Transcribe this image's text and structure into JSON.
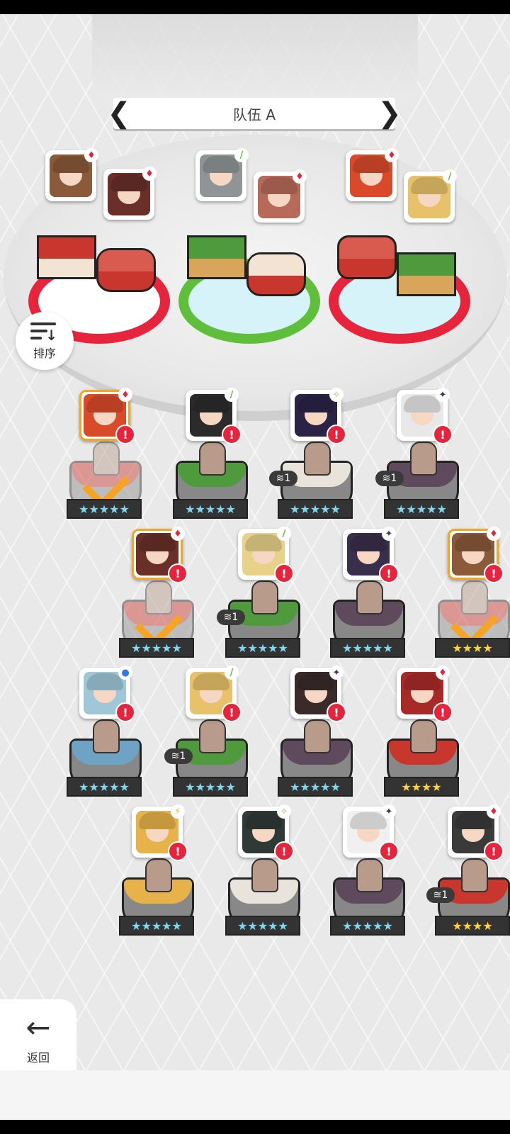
{
  "team": {
    "title": "队伍 A",
    "prev_icon": "chevron-left-icon",
    "next_icon": "chevron-right-icon"
  },
  "sort_button": {
    "label": "排序",
    "icon": "sort-descending-icon"
  },
  "back_button": {
    "label": "返回",
    "icon": "arrow-left-icon"
  },
  "elements": {
    "fire": "♦",
    "nature": "/",
    "light": "✧",
    "dark": "✦",
    "water": "●",
    "electric": "⚡"
  },
  "alert_text": "!",
  "colors": {
    "fire": "#e8243c",
    "nature": "#5fbf3a",
    "selected": "#f5a523",
    "alert": "#e8243c"
  },
  "roster": [
    {
      "id": "r1",
      "element": "fire",
      "stars": "★★★★★",
      "selected": true,
      "duplicates": null
    },
    {
      "id": "r2",
      "element": "nature",
      "stars": "★★★★★",
      "selected": false,
      "duplicates": null
    },
    {
      "id": "r3",
      "element": "light",
      "stars": "★★★★★",
      "selected": false,
      "duplicates": "1"
    },
    {
      "id": "r4",
      "element": "dark",
      "stars": "★★★★★",
      "selected": false,
      "duplicates": "1"
    },
    {
      "id": "r5",
      "element": "fire",
      "stars": "★★★★★",
      "selected": true,
      "duplicates": null
    },
    {
      "id": "r6",
      "element": "nature",
      "stars": "★★★★★",
      "selected": false,
      "duplicates": "1"
    },
    {
      "id": "r7",
      "element": "dark",
      "stars": "★★★★★",
      "selected": false,
      "duplicates": null
    },
    {
      "id": "r8",
      "element": "fire",
      "stars": "★★★★",
      "selected": true,
      "duplicates": null
    },
    {
      "id": "r9",
      "element": "water",
      "stars": "★★★★★",
      "selected": false,
      "duplicates": null
    },
    {
      "id": "r10",
      "element": "nature",
      "stars": "★★★★★",
      "selected": false,
      "duplicates": "1"
    },
    {
      "id": "r11",
      "element": "dark",
      "stars": "★★★★★",
      "selected": false,
      "duplicates": null
    },
    {
      "id": "r12",
      "element": "fire",
      "stars": "★★★★",
      "selected": false,
      "duplicates": null
    },
    {
      "id": "r13",
      "element": "electric",
      "stars": "★★★★★",
      "selected": false,
      "duplicates": null
    },
    {
      "id": "r14",
      "element": "light",
      "stars": "★★★★★",
      "selected": false,
      "duplicates": null
    },
    {
      "id": "r15",
      "element": "dark",
      "stars": "★★★★★",
      "selected": false,
      "duplicates": null
    },
    {
      "id": "r16",
      "element": "fire",
      "stars": "★★★★",
      "selected": false,
      "duplicates": "1"
    }
  ],
  "team_slots": [
    {
      "element": "fire"
    },
    {
      "element": "fire"
    },
    {
      "element": "nature"
    },
    {
      "element": "fire"
    },
    {
      "element": "fire"
    },
    {
      "element": "nature"
    }
  ]
}
